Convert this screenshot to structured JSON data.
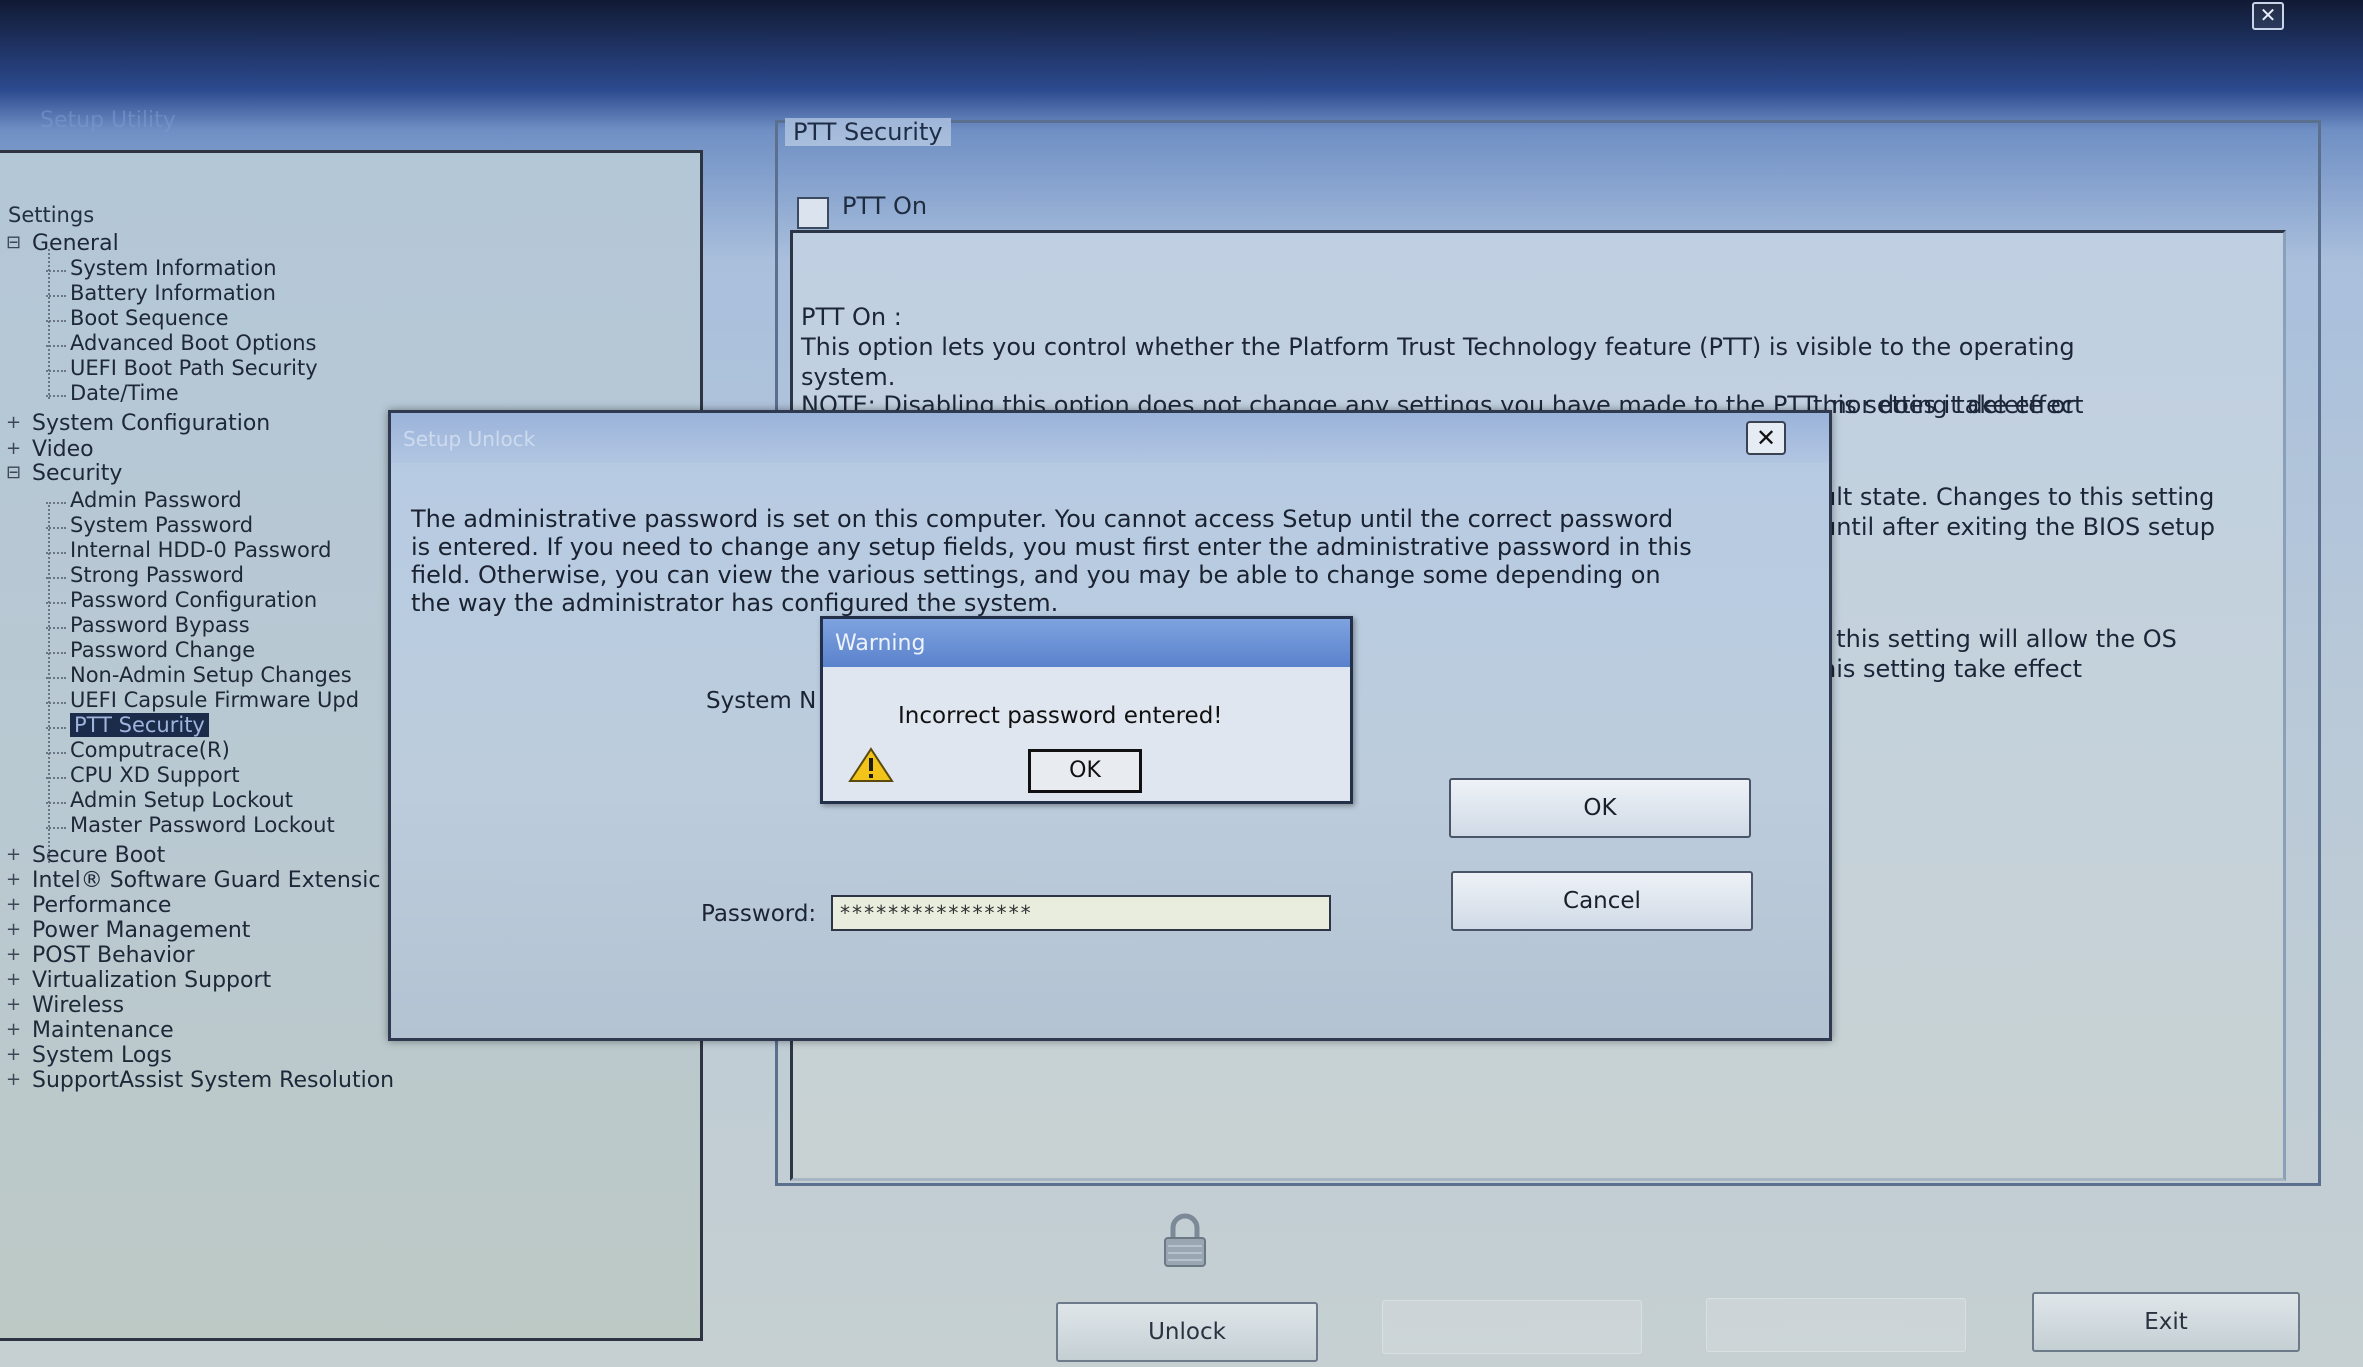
{
  "window": {
    "title": "Setup Utility"
  },
  "tree": {
    "root": "Settings",
    "items": [
      {
        "label": "General",
        "level": 1
      },
      {
        "label": "System Information",
        "level": 2
      },
      {
        "label": "Battery Information",
        "level": 2
      },
      {
        "label": "Boot Sequence",
        "level": 2
      },
      {
        "label": "Advanced Boot Options",
        "level": 2
      },
      {
        "label": "UEFI Boot Path Security",
        "level": 2
      },
      {
        "label": "Date/Time",
        "level": 2
      },
      {
        "label": "System Configuration",
        "level": 1
      },
      {
        "label": "Video",
        "level": 1
      },
      {
        "label": "Security",
        "level": 1
      },
      {
        "label": "Admin Password",
        "level": 2
      },
      {
        "label": "System Password",
        "level": 2
      },
      {
        "label": "Internal HDD-0 Password",
        "level": 2
      },
      {
        "label": "Strong Password",
        "level": 2
      },
      {
        "label": "Password Configuration",
        "level": 2
      },
      {
        "label": "Password Bypass",
        "level": 2
      },
      {
        "label": "Password Change",
        "level": 2
      },
      {
        "label": "Non-Admin Setup Changes",
        "level": 2
      },
      {
        "label": "UEFI Capsule Firmware Upd",
        "level": 2
      },
      {
        "label": "PTT Security",
        "level": 2,
        "selected": true
      },
      {
        "label": "Computrace(R)",
        "level": 2
      },
      {
        "label": "CPU XD Support",
        "level": 2
      },
      {
        "label": "Admin Setup Lockout",
        "level": 2
      },
      {
        "label": "Master Password Lockout",
        "level": 2
      },
      {
        "label": "Secure Boot",
        "level": 1
      },
      {
        "label": "Intel® Software Guard Extensic",
        "level": 1
      },
      {
        "label": "Performance",
        "level": 1
      },
      {
        "label": "Power Management",
        "level": 1
      },
      {
        "label": "POST Behavior",
        "level": 1
      },
      {
        "label": "Virtualization Support",
        "level": 1
      },
      {
        "label": "Wireless",
        "level": 1
      },
      {
        "label": "Maintenance",
        "level": 1
      },
      {
        "label": "System Logs",
        "level": 1
      },
      {
        "label": "SupportAssist System Resolution",
        "level": 1
      }
    ]
  },
  "content": {
    "group_title": "PTT Security",
    "checkbox_label": "PTT On",
    "checkbox_checked": false,
    "description": [
      "PTT On :",
      "This option lets you control whether the Platform Trust Technology feature (PTT) is visible to the operating",
      "system.",
      "NOTE: Disabling this option does not change any settings you have made to the PTT, nor does it delete or",
      "this setting take effect",
      "ult state. Changes to this setting",
      "until after exiting the BIOS setup",
      ", this setting will allow the OS",
      "his setting take effect"
    ]
  },
  "setup_dialog": {
    "title": "Setup Unlock",
    "message_lines": [
      "The administrative password is set on this computer.  You cannot access Setup until the correct password",
      "is entered.  If you need to change any setup fields, you must first enter the administrative password in this",
      "field.  Otherwise, you can view the various settings, and you may be able to change some depending on",
      "the way the administrator has configured the system."
    ],
    "system_label": "System N",
    "password_label": "Password:",
    "password_value": "****************",
    "ok_label": "OK",
    "cancel_label": "Cancel"
  },
  "warning_dialog": {
    "title": "Warning",
    "message": "Incorrect password entered!",
    "ok_label": "OK",
    "icon": "warning-triangle-icon"
  },
  "bottom": {
    "unlock_label": "Unlock",
    "exit_label": "Exit",
    "lock_icon": "lock-icon"
  }
}
